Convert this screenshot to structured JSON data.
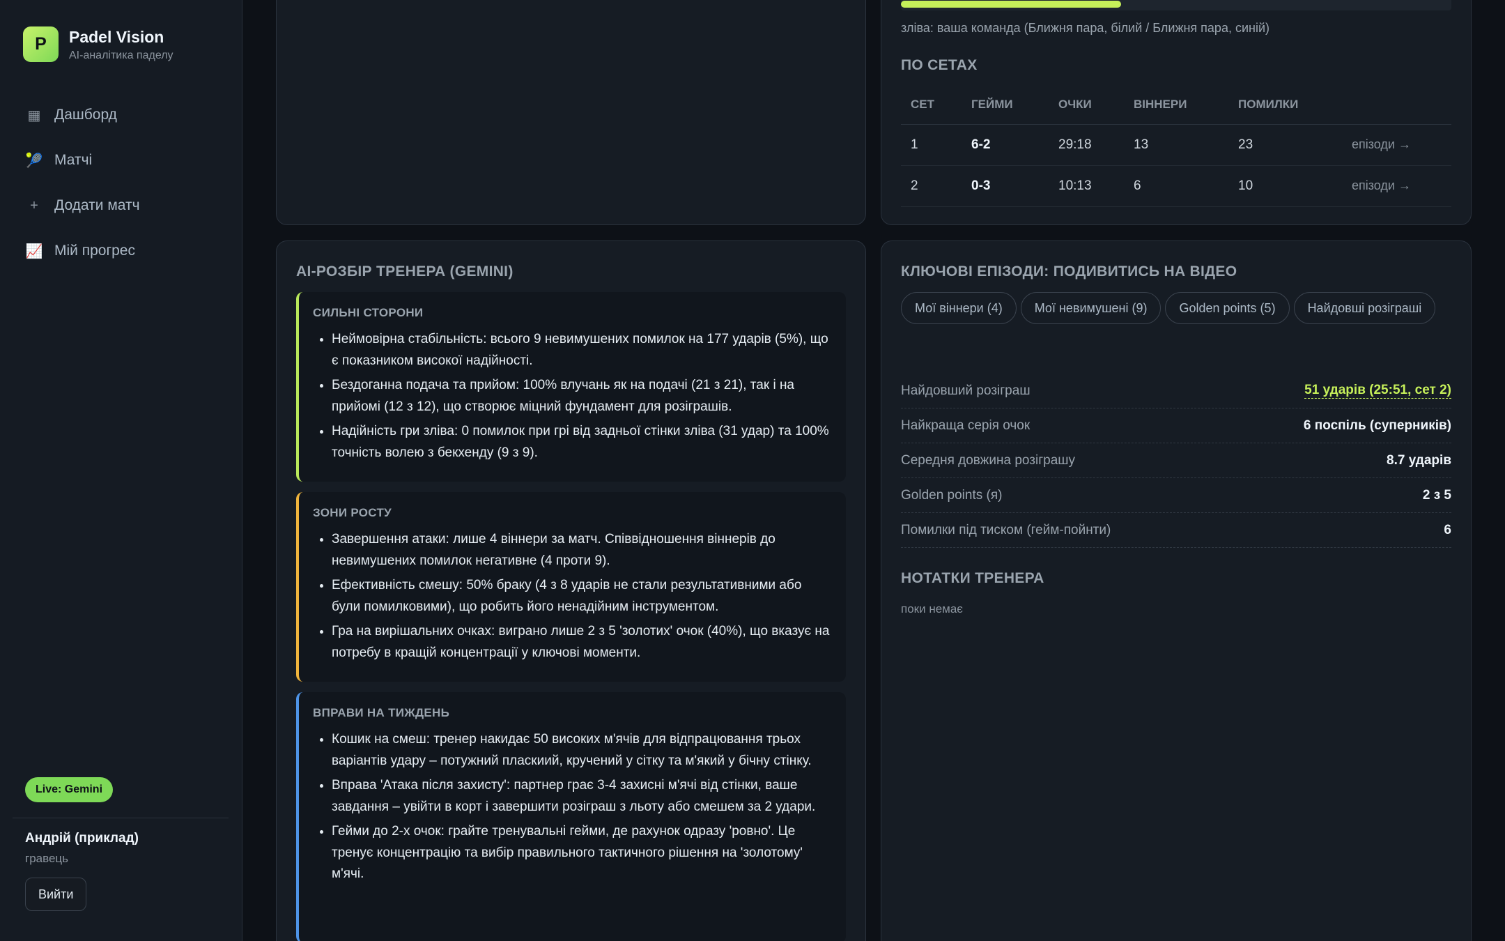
{
  "brand": {
    "logo_letter": "P",
    "name": "Padel Vision",
    "subtitle": "AI-аналітика паделу"
  },
  "nav": [
    {
      "icon": "▦",
      "label": "Дашборд"
    },
    {
      "icon": "🎾",
      "label": "Матчі"
    },
    {
      "icon": "+",
      "label": "Додати матч"
    },
    {
      "icon": "📈",
      "label": "Мій прогрес"
    }
  ],
  "live_badge": "Live: Gemini",
  "user": {
    "name": "Андрій (приклад)",
    "role": "гравець",
    "logout": "Вийти"
  },
  "top_card": {
    "progress_fraction": 0.4,
    "legend_note": "зліва: ваша команда (Ближня пара, білий / Ближня пара, синій)",
    "sets_title": "По сетах",
    "columns": [
      "Сет",
      "Гейми",
      "Очки",
      "Віннери",
      "Помилки",
      ""
    ],
    "rows": [
      {
        "set": "1",
        "games": "6-2",
        "points": "29:18",
        "winners": "13",
        "errors": "23",
        "link": "епізоди →"
      },
      {
        "set": "2",
        "games": "0-3",
        "points": "10:13",
        "winners": "6",
        "errors": "10",
        "link": "епізоди →"
      }
    ]
  },
  "ai_card": {
    "title": "AI-розбір тренера (Gemini)",
    "strengths": {
      "label": "Сильні сторони",
      "items": [
        "Неймовірна стабільність: всього 9 невимушених помилок на 177 ударів (5%), що є показником високої надійності.",
        "Бездоганна подача та прийом: 100% влучань як на подачі (21 з 21), так і на прийомі (12 з 12), що створює міцний фундамент для розіграшів.",
        "Надійність гри зліва: 0 помилок при грі від задньої стінки зліва (31 удар) та 100% точність волею з бекхенду (9 з 9)."
      ]
    },
    "growth": {
      "label": "Зони росту",
      "items": [
        "Завершення атаки: лише 4 віннери за матч. Співвідношення віннерів до невимушених помилок негативне (4 проти 9).",
        "Ефективність смешу: 50% браку (4 з 8 ударів не стали результативними або були помилковими), що робить його ненадійним інструментом.",
        "Гра на вирішальних очках: виграно лише 2 з 5 'золотих' очок (40%), що вказує на потребу в кращій концентрації у ключові моменти."
      ]
    },
    "drills": {
      "label": "Вправи на тиждень",
      "items": [
        "Кошик на смеш: тренер накидає 50 високих м'ячів для відпрацювання трьох варіантів удару – потужний пласкиий, кручений у сітку та м'який у бічну стінку.",
        "Вправа 'Атака після захисту': партнер грає 3-4 захисні м'ячі від стінки, ваше завдання – увійти в корт і завершити розіграш з льоту або смешем за 2 удари.",
        "Гейми до 2-х очок: грайте тренувальні гейми, де рахунок одразу 'ровно'. Це тренує концентрацію та вибір правильного тактичного рішення на 'золотому' м'ячі."
      ]
    }
  },
  "episodes_card": {
    "title": "Ключові епізоди: подивитись на відео",
    "chips": [
      "Мої віннери (4)",
      "Мої невимушені (9)",
      "Golden points (5)",
      "Найдовші розіграші"
    ],
    "stats": [
      {
        "label": "Найдовший розіграш",
        "value": "51 ударів (25:51, сет 2)",
        "accent": true
      },
      {
        "label": "Найкраща серія очок",
        "value": "6 поспіль (суперників)",
        "accent": false
      },
      {
        "label": "Середня довжина розіграшу",
        "value": "8.7 ударів",
        "accent": false
      },
      {
        "label": "Golden points (я)",
        "value": "2 з 5",
        "accent": false
      },
      {
        "label": "Помилки під тиском (гейм-пойнти)",
        "value": "6",
        "accent": false
      }
    ],
    "notes_title": "Нотатки тренера",
    "notes_empty": "поки немає"
  },
  "colors": {
    "accent": "#c6f05a",
    "live": "#7ed957",
    "growth": "#f0b43c",
    "drills": "#4e94e8",
    "background": "#0d1117"
  }
}
